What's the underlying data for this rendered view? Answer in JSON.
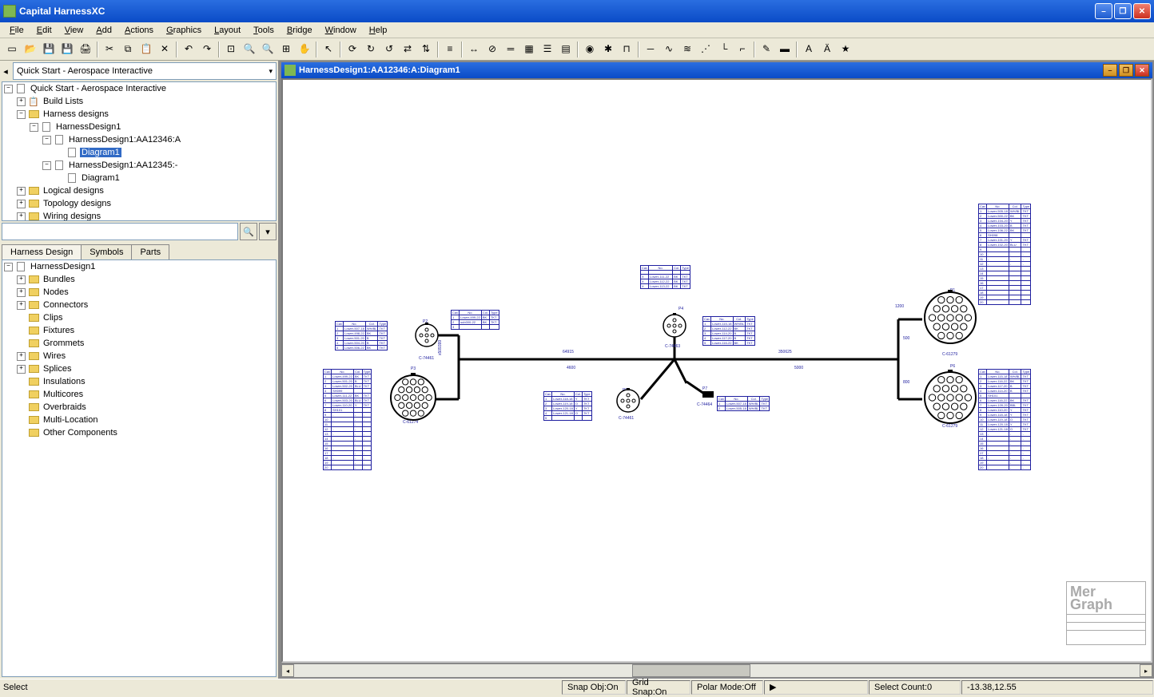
{
  "app": {
    "title": "Capital HarnessXC"
  },
  "menu": [
    "File",
    "Edit",
    "View",
    "Add",
    "Actions",
    "Graphics",
    "Layout",
    "Tools",
    "Bridge",
    "Window",
    "Help"
  ],
  "project_selector": "Quick Start - Aerospace Interactive",
  "tree1": {
    "root": "Quick Start - Aerospace Interactive",
    "build_lists": "Build Lists",
    "harness_designs": "Harness designs",
    "hd1": "HarnessDesign1",
    "hd1a": "HarnessDesign1:AA12346:A",
    "diag1": "Diagram1",
    "hd1b": "HarnessDesign1:AA12345:-",
    "diag2": "Diagram1",
    "logical": "Logical designs",
    "topology": "Topology designs",
    "wiring": "Wiring designs"
  },
  "tabs": {
    "t1": "Harness Design",
    "t2": "Symbols",
    "t3": "Parts"
  },
  "tree2": {
    "root": "HarnessDesign1",
    "items": [
      "Bundles",
      "Nodes",
      "Connectors",
      "Clips",
      "Fixtures",
      "Grommets",
      "Wires",
      "Splices",
      "Insulations",
      "Multicores",
      "Overbraids",
      "Multi-Location",
      "Other Components"
    ]
  },
  "document": {
    "title": "HarnessDesign1:AA12346:A:Diagram1"
  },
  "status": {
    "mode": "Select",
    "snap_obj": "Snap Obj:On",
    "grid_snap": "Grid Snap:On",
    "polar_mode": "Polar Mode:Off",
    "select_count": "Select Count:0",
    "coords": "-13.38,12.55"
  },
  "diagram": {
    "dims": {
      "top": "64915",
      "bl": "4600",
      "br": "5000",
      "conn_top": "350625",
      "left_seg": "x509399",
      "p3_dim": "1200",
      "right_v1": "500",
      "right_v2": "800"
    },
    "conn_labels": {
      "p1": "P1",
      "p2": "P2",
      "p3": "P3",
      "p4": "P4",
      "p5": "P5",
      "p6": "P6",
      "p7": "P7",
      "c1": "C-74461",
      "c2": "C-61274",
      "c3": "C-74463",
      "c4": "C-74461",
      "c5": "C-74464",
      "c6": "C-61279",
      "c7": "C-61279"
    },
    "headers": [
      "Cav",
      "No.",
      "Col.",
      "Type"
    ],
    "table_p2": [
      [
        "1",
        "Lower-507-18",
        "WH/BL",
        "TKT"
      ],
      [
        "2",
        "Lower-498-22",
        "BK",
        "TKT"
      ],
      [
        "3",
        "Lower-501-20",
        "B",
        "TKT"
      ],
      [
        "4",
        "Lower-504-20",
        "B",
        "TKT"
      ],
      [
        "5",
        "Lower-506-22",
        "BK",
        "TKT"
      ]
    ],
    "table_p2b": [
      [
        "1",
        "Lower-499-22",
        "BK",
        "TKT"
      ],
      [
        "2",
        "sub000-22",
        "BK",
        "TKT"
      ],
      [
        "3",
        "",
        "",
        ""
      ]
    ],
    "table_p3": [
      [
        "1",
        "Lower-499-22",
        "BK",
        "TKT"
      ],
      [
        "2",
        "Lower-501-20",
        "B",
        "TKT"
      ],
      [
        "3",
        "Lower-502-20",
        "BLU",
        "TKT"
      ],
      [
        "4",
        "SH099",
        "",
        ""
      ],
      [
        "5",
        "Lower-111-22",
        "BK",
        "TKT"
      ],
      [
        "6",
        "Lower-503-20",
        "BLU",
        "TKT"
      ],
      [
        "7",
        "Lower-110-20",
        "Y",
        "TKT"
      ],
      [
        "8",
        "SH101",
        "",
        ""
      ],
      [
        "9",
        "-",
        "-",
        "-"
      ],
      [
        "10",
        "-",
        "-",
        "-"
      ],
      [
        "11",
        "-",
        "-",
        "-"
      ],
      [
        "12",
        "-",
        "-",
        "-"
      ],
      [
        "13",
        "-",
        "-",
        "-"
      ],
      [
        "14",
        "-",
        "-",
        "-"
      ],
      [
        "15",
        "-",
        "-",
        "-"
      ],
      [
        "16",
        "-",
        "-",
        "-"
      ],
      [
        "17",
        "-",
        "-",
        "-"
      ],
      [
        "18",
        "-",
        "-",
        "-"
      ],
      [
        "19",
        "-",
        "-",
        "-"
      ],
      [
        "20",
        "-",
        "-",
        "-"
      ]
    ],
    "table_p4_top": [
      [
        "X",
        "Lower-111-22",
        "BK",
        "TKT"
      ],
      [
        "X",
        "Lower-112-22",
        "BK",
        "TKT"
      ],
      [
        "X",
        "Lower-113-22",
        "BK",
        "TKT"
      ]
    ],
    "table_p4_right": [
      [
        "1",
        "Lower-115-18",
        "WH/BL",
        "TKT"
      ],
      [
        "2",
        "Lower-112-22",
        "BK",
        "TKT"
      ],
      [
        "3",
        "Lower-114-20",
        "B",
        "TKT"
      ],
      [
        "4",
        "Lower-117-20",
        "B",
        "TKT"
      ],
      [
        "5",
        "Lower-116-22",
        "BK",
        "TKT"
      ]
    ],
    "table_p5": [
      [
        "1",
        "Lower-118-18",
        "Y",
        "TKT"
      ],
      [
        "2",
        "Lower-119-18",
        "O",
        "TKT"
      ],
      [
        "3",
        "Lower-120-18",
        "Y",
        "TKT"
      ],
      [
        "4",
        "Lower-121-18",
        "O",
        "TKT"
      ],
      [
        "5",
        "",
        "",
        ""
      ]
    ],
    "table_p7": [
      [
        "1",
        "Lower-507-18",
        "WH/BL",
        "TKT"
      ],
      [
        "2",
        "Lower-505-18",
        "WH/BL",
        "TKT"
      ]
    ],
    "table_p1": [
      [
        "1",
        "Lower-505-18",
        "WH/BL",
        "TKT"
      ],
      [
        "2",
        "Lower-500-22",
        "BK",
        "TKT"
      ],
      [
        "3",
        "Lower-104-20",
        "Y",
        "TKT"
      ],
      [
        "4",
        "Lower-103-20",
        "B",
        "TKT"
      ],
      [
        "5",
        "Lower-106-22",
        "BK",
        "TKT"
      ],
      [
        "6",
        "SH098",
        "",
        ""
      ],
      [
        "7",
        "Lower-101-20",
        "Y",
        "TKT"
      ],
      [
        "8",
        "Lower-102-20",
        "BLU",
        "TKT"
      ],
      [
        "9",
        "-",
        "-",
        "-"
      ],
      [
        "10",
        "-",
        "-",
        "-"
      ],
      [
        "11",
        "-",
        "-",
        "-"
      ],
      [
        "12",
        "-",
        "-",
        "-"
      ],
      [
        "13",
        "",
        "",
        ""
      ],
      [
        "14",
        "",
        "",
        ""
      ],
      [
        "15",
        "",
        "",
        ""
      ],
      [
        "16",
        "",
        "",
        ""
      ],
      [
        "17",
        "",
        "",
        ""
      ],
      [
        "18",
        "",
        "",
        ""
      ],
      [
        "19",
        "",
        "",
        ""
      ],
      [
        "20",
        "",
        "",
        ""
      ]
    ],
    "table_p6": [
      [
        "1",
        "Lower-115-18",
        "WH/BL",
        "TKT"
      ],
      [
        "2",
        "Lower-116-22",
        "BK",
        "TKT"
      ],
      [
        "3",
        "Lower-117-20",
        "B",
        "TKT"
      ],
      [
        "4",
        "Lower-114-20",
        "B",
        "TKT"
      ],
      [
        "5",
        "SH101",
        "",
        ""
      ],
      [
        "6",
        "Lower-116-22",
        "BK",
        "TKT"
      ],
      [
        "7",
        "Lower-109-20",
        "BBL",
        "TKT"
      ],
      [
        "8",
        "Lower-110-20",
        "Y",
        "TKT"
      ],
      [
        "9",
        "Lower-118-18",
        "Y",
        "TKT"
      ],
      [
        "10",
        "Lower-119-18",
        "O",
        "TKT"
      ],
      [
        "11",
        "Lower-120-18",
        "Y",
        "TKT"
      ],
      [
        "12",
        "Lower-121-18",
        "O",
        "TKT"
      ],
      [
        "13",
        "-",
        "-",
        "-"
      ],
      [
        "14",
        "-",
        "-",
        "-"
      ],
      [
        "15",
        "-",
        "-",
        "-"
      ],
      [
        "16",
        "-",
        "-",
        "-"
      ],
      [
        "17",
        "-",
        "-",
        "-"
      ],
      [
        "18",
        "-",
        "-",
        "-"
      ],
      [
        "19",
        "-",
        "-",
        "-"
      ],
      [
        "20",
        "-",
        "-",
        "-"
      ]
    ]
  },
  "watermark": "Mer\nGraph"
}
